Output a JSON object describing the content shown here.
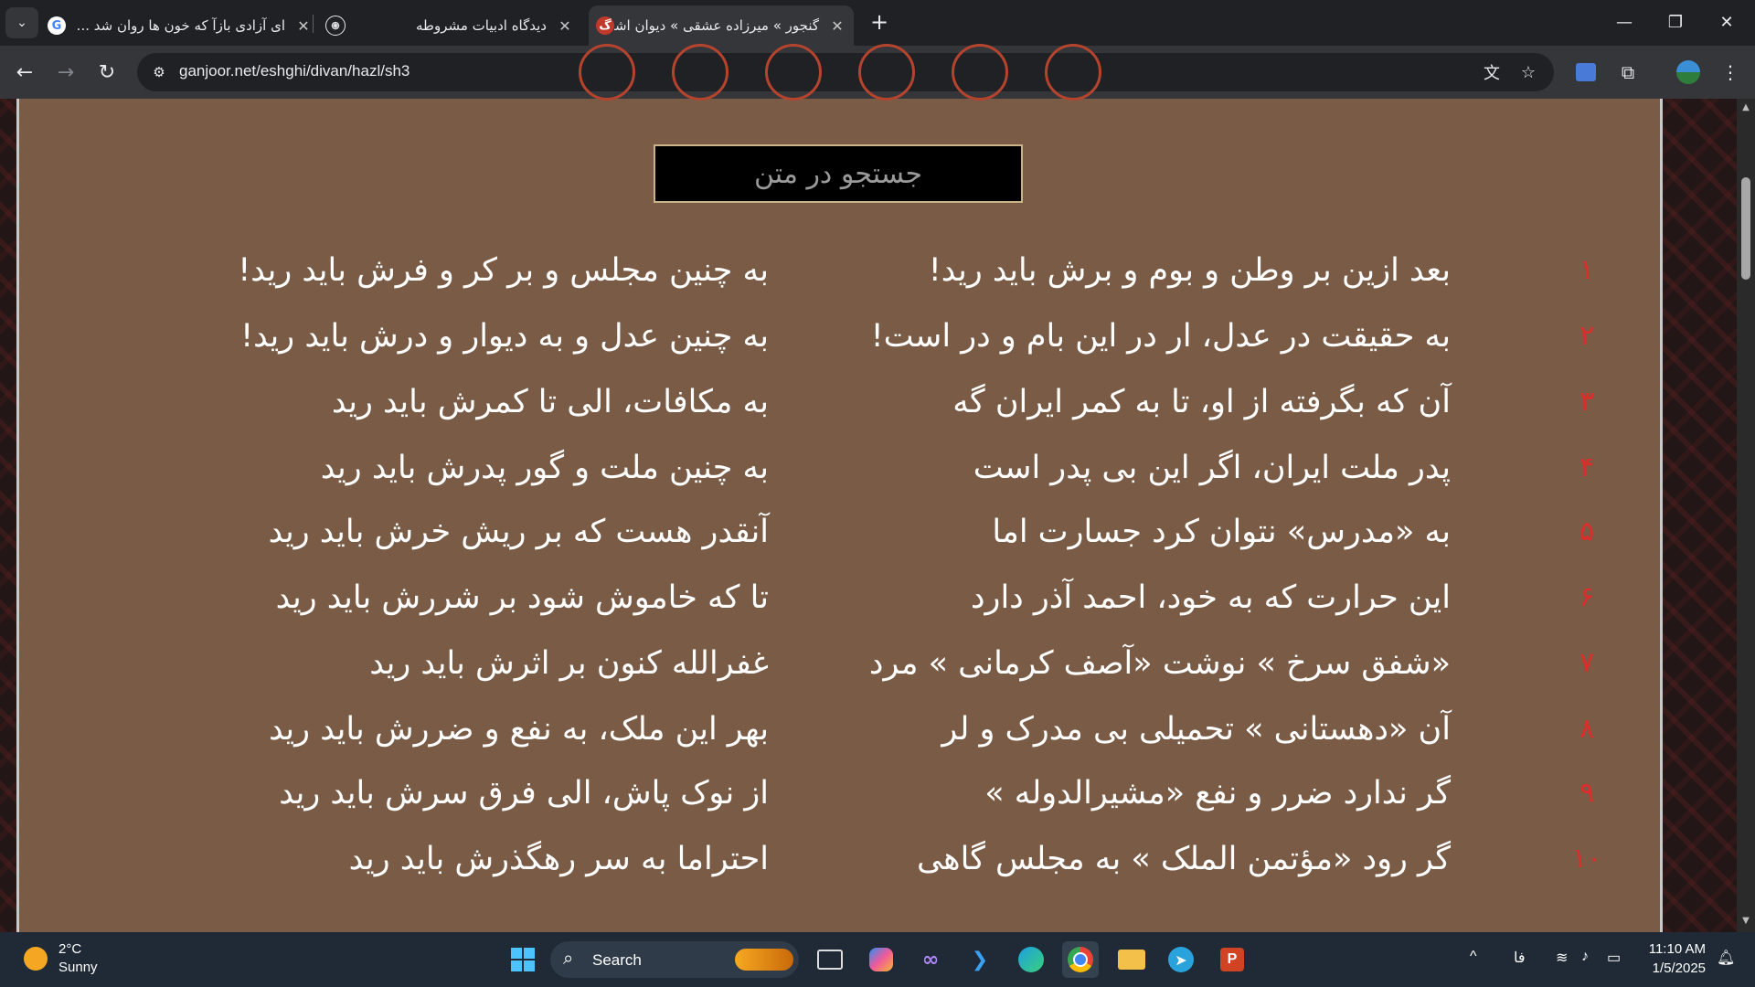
{
  "browser": {
    "tabs": [
      {
        "title": "ای آزادی بازآ که خون ها روان شد ...",
        "favicon": "google-icon"
      },
      {
        "title": "دیدگاه ادبیات مشروطه",
        "favicon": "chatgpt-icon"
      },
      {
        "title": "گنجور » میرزاده عشقی » دیوان اشعار",
        "favicon": "ganjoor-icon",
        "active": true
      }
    ],
    "url": "ganjoor.net/eshghi/divan/hazl/sh3"
  },
  "page": {
    "search_label": "جستجو در متن",
    "verses": [
      {
        "num": "۱",
        "m1": "بعد ازین بر وطن و بوم و برش باید رید!",
        "m2": "به چنین مجلس و بر کر و فرش باید رید!"
      },
      {
        "num": "۲",
        "m1": "به حقیقت در عدل، ار در این بام و در است!",
        "m2": "به چنین عدل و به دیوار و درش باید رید!"
      },
      {
        "num": "۳",
        "m1": "آن که بگرفته از او، تا به کمر ایران گه",
        "m2": "به مکافات، الی تا کمرش باید رید"
      },
      {
        "num": "۴",
        "m1": "پدر ملت ایران، اگر این بی پدر است",
        "m2": "به چنین ملت و گور پدرش باید رید"
      },
      {
        "num": "۵",
        "m1": "به «مدرس» نتوان کرد جسارت اما",
        "m2": "آنقدر هست که بر ریش خرش باید رید"
      },
      {
        "num": "۶",
        "m1": "این حرارت که به خود، احمد آذر دارد",
        "m2": "تا که خاموش شود بر شررش باید رید"
      },
      {
        "num": "۷",
        "m1": "«شفق سرخ » نوشت «آصف کرمانی » مرد",
        "m2": "غفرالله کنون بر اثرش باید رید"
      },
      {
        "num": "۸",
        "m1": "آن «دهستانی » تحمیلی بی مدرک و لر",
        "m2": "بهر این ملک، به نفع و ضررش باید رید"
      },
      {
        "num": "۹",
        "m1": "گر ندارد ضرر و نفع «مشیرالدوله »",
        "m2": "از نوک پاش، الی فرق سرش باید رید"
      },
      {
        "num": "۱۰",
        "m1": "گر رود «مؤتمن الملک » به مجلس گاهی",
        "m2": "احتراما به سر رهگذرش باید رید"
      }
    ]
  },
  "taskbar": {
    "weather": {
      "temp": "2°C",
      "condition": "Sunny"
    },
    "search_label": "Search",
    "language": "فا",
    "time": "11:10 AM",
    "date": "1/5/2025"
  }
}
